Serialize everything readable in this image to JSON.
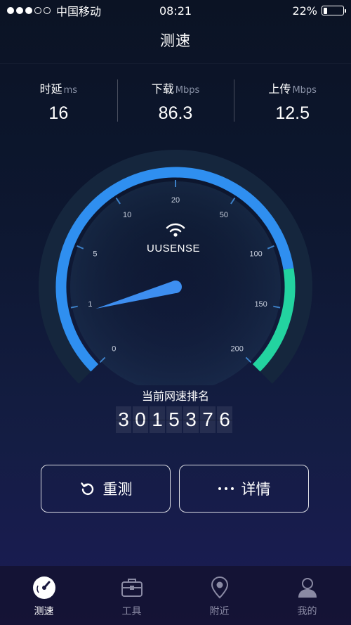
{
  "status": {
    "carrier": "中国移动",
    "time": "08:21",
    "battery": "22%",
    "battery_level": 0.22,
    "signal_bars": 3
  },
  "title": "测速",
  "stats": [
    {
      "label": "时延",
      "unit": "ms",
      "value": "16"
    },
    {
      "label": "下载",
      "unit": "Mbps",
      "value": "86.3"
    },
    {
      "label": "上传",
      "unit": "Mbps",
      "value": "12.5"
    }
  ],
  "gauge": {
    "brand": "UUSENSE",
    "ticks": [
      "0",
      "1",
      "5",
      "10",
      "20",
      "50",
      "100",
      "150",
      "200"
    ],
    "needle_value": 0.11,
    "colors": {
      "blue": "#2f8ff0",
      "green": "#23d3a0",
      "track": "#1a2c47"
    }
  },
  "rank": {
    "label": "当前网速排名",
    "digits": [
      "3",
      "0",
      "1",
      "5",
      "3",
      "7",
      "6"
    ]
  },
  "buttons": {
    "retest": "重测",
    "detail": "详情"
  },
  "tabs": [
    {
      "label": "测速",
      "icon": "speedometer-icon",
      "active": true
    },
    {
      "label": "工具",
      "icon": "toolbox-icon",
      "active": false
    },
    {
      "label": "附近",
      "icon": "location-pin-icon",
      "active": false
    },
    {
      "label": "我的",
      "icon": "user-icon",
      "active": false
    }
  ]
}
